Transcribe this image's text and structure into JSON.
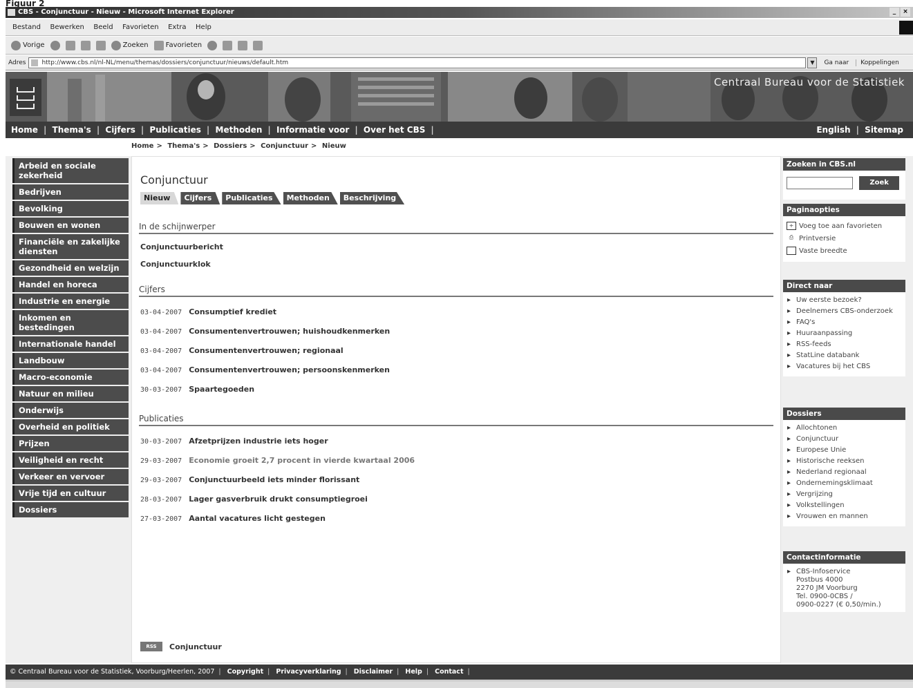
{
  "figure_caption": "Figuur 2",
  "window": {
    "title": "CBS - Conjunctuur - Nieuw - Microsoft Internet Explorer",
    "controls": [
      "_",
      "×"
    ]
  },
  "menu": [
    "Bestand",
    "Bewerken",
    "Beeld",
    "Favorieten",
    "Extra",
    "Help"
  ],
  "toolbar": {
    "back": "Vorige",
    "search": "Zoeken",
    "favorites": "Favorieten"
  },
  "address": {
    "label": "Adres",
    "url": "http://www.cbs.nl/nl-NL/menu/themas/dossiers/conjunctuur/nieuws/default.htm",
    "go": "Ga naar",
    "links": "Koppelingen"
  },
  "banner": {
    "slogan": "Centraal Bureau voor de Statistiek"
  },
  "topnav": {
    "items": [
      "Home",
      "Thema's",
      "Cijfers",
      "Publicaties",
      "Methoden",
      "Informatie voor",
      "Over het CBS"
    ],
    "right": [
      "English",
      "Sitemap"
    ]
  },
  "breadcrumb": [
    "Home",
    "Thema's",
    "Dossiers",
    "Conjunctuur",
    "Nieuw"
  ],
  "leftnav": [
    "Arbeid en sociale zekerheid",
    "Bedrijven",
    "Bevolking",
    "Bouwen en wonen",
    "Financiële en zakelijke diensten",
    "Gezondheid en welzijn",
    "Handel en horeca",
    "Industrie en energie",
    "Inkomen en bestedingen",
    "Internationale handel",
    "Landbouw",
    "Macro-economie",
    "Natuur en milieu",
    "Onderwijs",
    "Overheid en politiek",
    "Prijzen",
    "Veiligheid en recht",
    "Verkeer en vervoer",
    "Vrije tijd en cultuur",
    "Dossiers"
  ],
  "main": {
    "title": "Conjunctuur",
    "tabs": [
      "Nieuw",
      "Cijfers",
      "Publicaties",
      "Methoden",
      "Beschrijving"
    ],
    "spotlight": {
      "heading": "In de schijnwerper",
      "items": [
        "Conjunctuurbericht",
        "Conjunctuurklok"
      ]
    },
    "cijfers": {
      "heading": "Cijfers",
      "items": [
        {
          "date": "03-04-2007",
          "title": "Consumptief krediet"
        },
        {
          "date": "03-04-2007",
          "title": "Consumentenvertrouwen; huishoudkenmerken"
        },
        {
          "date": "03-04-2007",
          "title": "Consumentenvertrouwen; regionaal"
        },
        {
          "date": "03-04-2007",
          "title": "Consumentenvertrouwen; persoonskenmerken"
        },
        {
          "date": "30-03-2007",
          "title": "Spaartegoeden"
        }
      ]
    },
    "publicaties": {
      "heading": "Publicaties",
      "items": [
        {
          "date": "30-03-2007",
          "title": "Afzetprijzen industrie iets hoger"
        },
        {
          "date": "29-03-2007",
          "title": "Economie groeit 2,7 procent in vierde kwartaal 2006"
        },
        {
          "date": "29-03-2007",
          "title": "Conjunctuurbeeld iets minder florissant"
        },
        {
          "date": "28-03-2007",
          "title": "Lager gasverbruik drukt consumptiegroei"
        },
        {
          "date": "27-03-2007",
          "title": "Aantal vacatures licht gestegen"
        }
      ]
    },
    "rss": {
      "badge": "RSS",
      "label": "Conjunctuur"
    }
  },
  "right": {
    "search": {
      "heading": "Zoeken in CBS.nl",
      "button": "Zoek"
    },
    "options": {
      "heading": "Paginaopties",
      "items": [
        "Voeg toe aan favorieten",
        "Printversie",
        "Vaste breedte"
      ]
    },
    "direct": {
      "heading": "Direct naar",
      "items": [
        "Uw eerste bezoek?",
        "Deelnemers CBS-onderzoek",
        "FAQ's",
        "Huuraanpassing",
        "RSS-feeds",
        "StatLine databank",
        "Vacatures bij het CBS"
      ]
    },
    "dossiers": {
      "heading": "Dossiers",
      "items": [
        "Allochtonen",
        "Conjunctuur",
        "Europese Unie",
        "Historische reeksen",
        "Nederland regionaal",
        "Ondernemingsklimaat",
        "Vergrijzing",
        "Volkstellingen",
        "Vrouwen en mannen"
      ]
    },
    "contact": {
      "heading": "Contactinformatie",
      "lines": [
        "CBS-Infoservice",
        "Postbus 4000",
        "2270 JM Voorburg",
        "Tel. 0900-0CBS /",
        "0900-0227 (€ 0,50/min.)"
      ]
    }
  },
  "footer": {
    "copyright": "© Centraal Bureau voor de Statistiek, Voorburg/Heerlen, 2007",
    "links": [
      "Copyright",
      "Privacyverklaring",
      "Disclaimer",
      "Help",
      "Contact"
    ]
  }
}
